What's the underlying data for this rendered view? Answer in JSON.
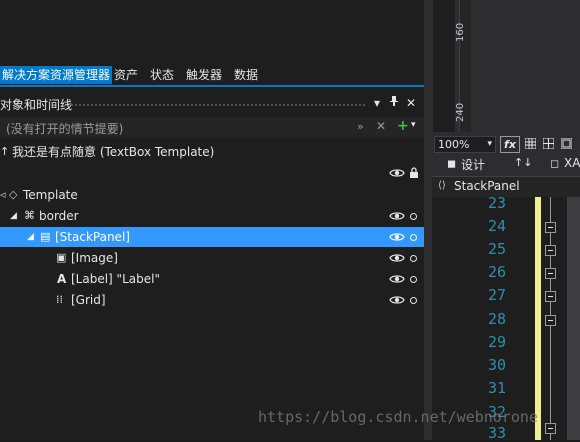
{
  "tabs": [
    {
      "label": "解决方案资源管理器",
      "active": true
    },
    {
      "label": "资产",
      "active": false
    },
    {
      "label": "状态",
      "active": false
    },
    {
      "label": "触发器",
      "active": false
    },
    {
      "label": "数据",
      "active": false
    }
  ],
  "objects_panel": {
    "title": "对象和时间线",
    "search_placeholder": "(没有打开的情节提要)"
  },
  "scope": {
    "label": "我还是有点随意 (TextBox Template)"
  },
  "tree": [
    {
      "label": "Template",
      "icon": "template-icon"
    },
    {
      "label": "border",
      "icon": "border-icon"
    },
    {
      "label": "[StackPanel]",
      "icon": "stackpanel-icon",
      "selected": true
    },
    {
      "label": "[Image]",
      "icon": "image-icon"
    },
    {
      "label": "[Label] \"Label\"",
      "icon": "label-icon"
    },
    {
      "label": "[Grid]",
      "icon": "grid-icon"
    }
  ],
  "ruler": {
    "marks": [
      "160",
      "240"
    ]
  },
  "editor": {
    "zoom": "100%",
    "fx_label": "fx",
    "design_tab": "设计",
    "swap_label": "↑↓",
    "xaml_tab": "XA",
    "breadcrumb": "StackPanel",
    "line_numbers": [
      "23",
      "24",
      "25",
      "26",
      "27",
      "28",
      "29",
      "30",
      "31",
      "32",
      "33"
    ]
  },
  "watermark": "https://blog.csdn.net/webnorone"
}
